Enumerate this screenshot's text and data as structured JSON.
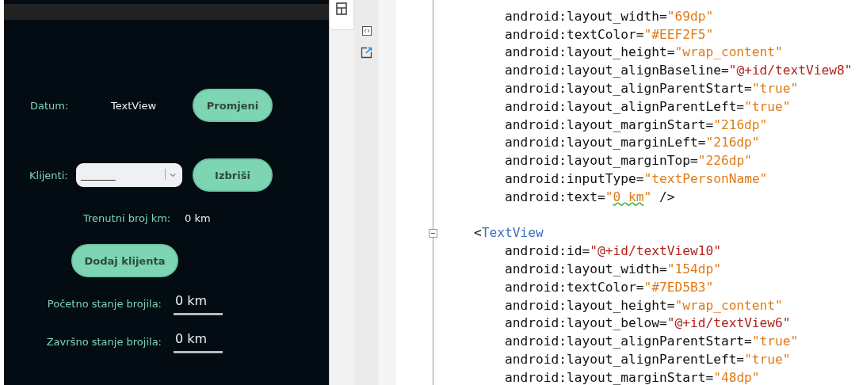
{
  "preview": {
    "date_row": {
      "label": "Datum:",
      "value": "TextView",
      "button": "Promjeni"
    },
    "client_row": {
      "label": "Klijenti:",
      "button": "Izbriši"
    },
    "km_row": {
      "label": "Trenutni broj km:",
      "value": "0 km"
    },
    "add_button": "Dodaj klijenta",
    "odometer_fields": [
      {
        "label": "Početno stanje brojila:",
        "value": "0 km"
      },
      {
        "label": "Završno stanje brojila:",
        "value": "0 km"
      }
    ]
  },
  "editor": {
    "blocks": [
      {
        "lines": [
          [
            {
              "text": "android:layout_width=",
              "kind": "attr"
            },
            {
              "text": "\"69dp\"",
              "kind": "literal"
            }
          ],
          [
            {
              "text": "android:textColor=",
              "kind": "attr"
            },
            {
              "text": "\"#EEF2F5\"",
              "kind": "literal"
            }
          ],
          [
            {
              "text": "android:layout_height=",
              "kind": "attr"
            },
            {
              "text": "\"wrap_content\"",
              "kind": "literal"
            }
          ],
          [
            {
              "text": "android:layout_alignBaseline=",
              "kind": "attr"
            },
            {
              "text": "\"@+id/textView8\"",
              "kind": "reference"
            }
          ],
          [
            {
              "text": "android:layout_alignParentStart=",
              "kind": "attr"
            },
            {
              "text": "\"true\"",
              "kind": "literal"
            }
          ],
          [
            {
              "text": "android:layout_alignParentLeft=",
              "kind": "attr"
            },
            {
              "text": "\"true\"",
              "kind": "literal"
            }
          ],
          [
            {
              "text": "android:layout_marginStart=",
              "kind": "attr"
            },
            {
              "text": "\"216dp\"",
              "kind": "literal"
            }
          ],
          [
            {
              "text": "android:layout_marginLeft=",
              "kind": "attr"
            },
            {
              "text": "\"216dp\"",
              "kind": "literal"
            }
          ],
          [
            {
              "text": "android:layout_marginTop=",
              "kind": "attr"
            },
            {
              "text": "\"226dp\"",
              "kind": "literal"
            }
          ],
          [
            {
              "text": "android:inputType=",
              "kind": "attr"
            },
            {
              "text": "\"textPersonName\"",
              "kind": "literal"
            }
          ],
          [
            {
              "text": "android:text=",
              "kind": "attr"
            },
            {
              "text": "\"",
              "kind": "literal"
            },
            {
              "text": "0 km",
              "kind": "literal",
              "warning": true
            },
            {
              "text": "\"",
              "kind": "literal"
            },
            {
              "text": " />",
              "kind": "attr"
            }
          ]
        ]
      },
      {
        "tag_line": [
          {
            "text": "<",
            "kind": "attr"
          },
          {
            "text": "TextView",
            "kind": "tag"
          }
        ],
        "lines": [
          [
            {
              "text": "android:id=",
              "kind": "attr"
            },
            {
              "text": "\"@+id/textView10\"",
              "kind": "reference"
            }
          ],
          [
            {
              "text": "android:layout_width=",
              "kind": "attr"
            },
            {
              "text": "\"154dp\"",
              "kind": "literal"
            }
          ],
          [
            {
              "text": "android:textColor=",
              "kind": "attr"
            },
            {
              "text": "\"#7ED5B3\"",
              "kind": "literal"
            }
          ],
          [
            {
              "text": "android:layout_height=",
              "kind": "attr"
            },
            {
              "text": "\"wrap_content\"",
              "kind": "literal"
            }
          ],
          [
            {
              "text": "android:layout_below=",
              "kind": "attr"
            },
            {
              "text": "\"@+id/textView6\"",
              "kind": "reference"
            }
          ],
          [
            {
              "text": "android:layout_alignParentStart=",
              "kind": "attr"
            },
            {
              "text": "\"true\"",
              "kind": "literal"
            }
          ],
          [
            {
              "text": "android:layout_alignParentLeft=",
              "kind": "attr"
            },
            {
              "text": "\"true\"",
              "kind": "literal"
            }
          ],
          [
            {
              "text": "android:layout_marginStart=",
              "kind": "attr"
            },
            {
              "text": "\"48dp\"",
              "kind": "literal"
            }
          ]
        ]
      }
    ]
  }
}
